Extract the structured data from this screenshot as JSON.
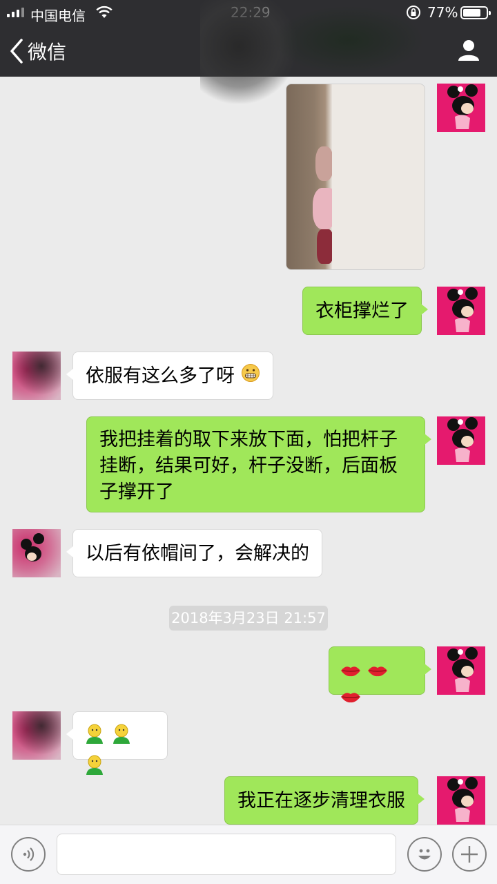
{
  "status_bar": {
    "carrier": "中国电信",
    "time": "22:29",
    "battery_percent": "77%",
    "battery_level": 0.77
  },
  "nav": {
    "back_label": "微信",
    "back_icon": "chevron-left-icon",
    "profile_icon": "person-icon"
  },
  "messages": [
    {
      "side": "me",
      "type": "image"
    },
    {
      "side": "me",
      "type": "text",
      "text": "衣柜撑烂了"
    },
    {
      "side": "other",
      "type": "text",
      "text": "依服有这么多了呀",
      "emoji": "grin-emoji"
    },
    {
      "side": "me",
      "type": "text",
      "text": "我把挂着的取下来放下面，怕把杆子挂断，结果可好，杆子没断，后面板子撑开了"
    },
    {
      "side": "other",
      "type": "text",
      "text": "以后有依帽间了，会解决的"
    },
    {
      "side": "system",
      "type": "timestamp",
      "text": "2018年3月23日 21:57"
    },
    {
      "side": "me",
      "type": "emoji",
      "emoji": "lips-emoji",
      "count": 3
    },
    {
      "side": "other",
      "type": "emoji",
      "emoji": "green-person-emoji",
      "count": 3
    },
    {
      "side": "me",
      "type": "text",
      "text": "我正在逐步清理衣服"
    }
  ],
  "input_bar": {
    "voice_icon": "voice-icon",
    "emoji_icon": "smiley-icon",
    "plus_icon": "plus-icon",
    "text_value": ""
  },
  "colors": {
    "nav_background": "#2e2e31",
    "chat_background": "#ebebeb",
    "my_bubble": "#a0e75a",
    "other_bubble": "#ffffff",
    "avatar_pink": "#e51a6e"
  }
}
